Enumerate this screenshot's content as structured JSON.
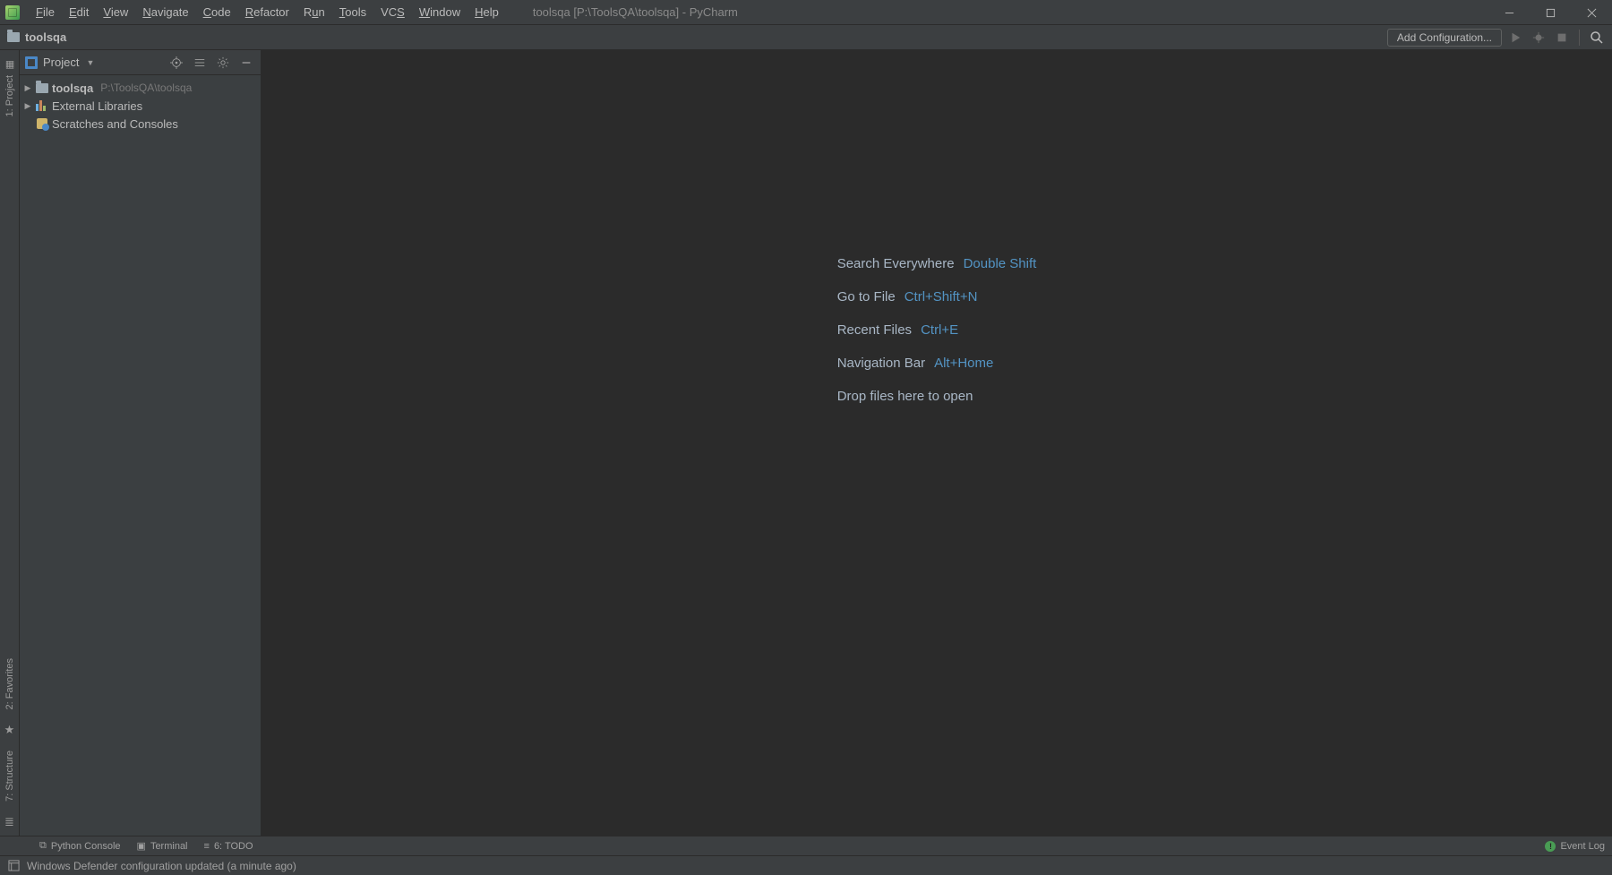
{
  "window_title": "toolsqa [P:\\ToolsQA\\toolsqa] - PyCharm",
  "menus": [
    "File",
    "Edit",
    "View",
    "Navigate",
    "Code",
    "Refactor",
    "Run",
    "Tools",
    "VCS",
    "Window",
    "Help"
  ],
  "breadcrumb": "toolsqa",
  "add_config": "Add Configuration...",
  "project_tool": {
    "title": "Project",
    "items": [
      {
        "label": "toolsqa",
        "path": "P:\\ToolsQA\\toolsqa",
        "kind": "folder",
        "expandable": true
      },
      {
        "label": "External Libraries",
        "kind": "lib",
        "expandable": true
      },
      {
        "label": "Scratches and Consoles",
        "kind": "scratch",
        "expandable": false
      }
    ]
  },
  "hints": [
    {
      "label": "Search Everywhere",
      "key": "Double Shift"
    },
    {
      "label": "Go to File",
      "key": "Ctrl+Shift+N"
    },
    {
      "label": "Recent Files",
      "key": "Ctrl+E"
    },
    {
      "label": "Navigation Bar",
      "key": "Alt+Home"
    },
    {
      "label": "Drop files here to open",
      "key": ""
    }
  ],
  "left_gutter": {
    "top": "1: Project",
    "favorites": "2: Favorites",
    "structure": "7: Structure"
  },
  "bottom_tabs": {
    "console": "Python Console",
    "terminal": "Terminal",
    "todo": "6: TODO",
    "event_log": "Event Log"
  },
  "statusbar": "Windows Defender configuration updated (a minute ago)"
}
